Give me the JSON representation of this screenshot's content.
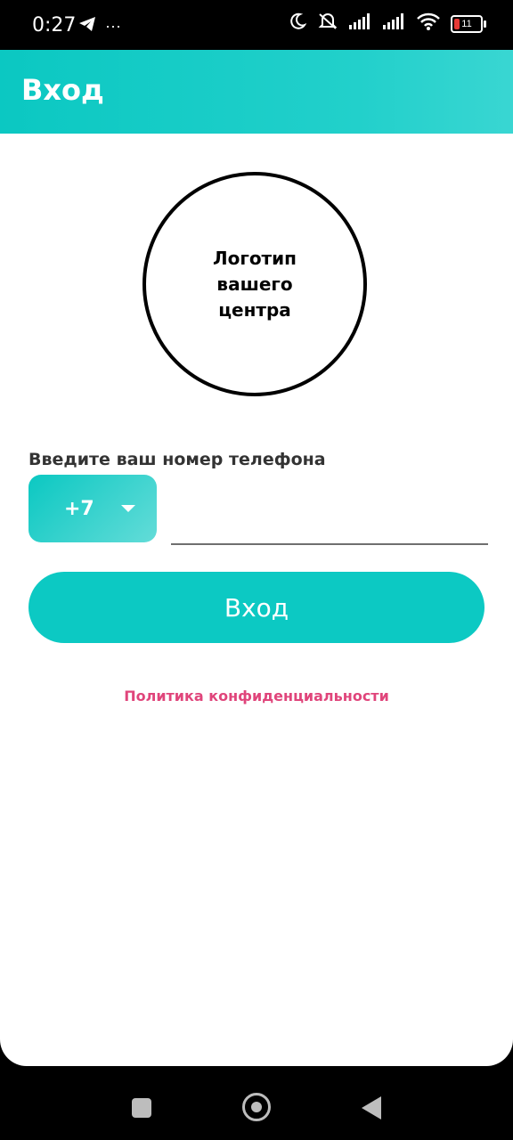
{
  "status_bar": {
    "time": "0:27",
    "more_dots": "···",
    "battery_level": "11"
  },
  "header": {
    "title": "Вход"
  },
  "logo": {
    "text": "Логотип\nвашего\nцентра"
  },
  "phone": {
    "label": "Введите ваш номер телефона",
    "country_code": "+7",
    "value": "",
    "placeholder": ""
  },
  "login_button": {
    "label": "Вход"
  },
  "privacy_link": {
    "text": "Политика конфиденциальности"
  },
  "colors": {
    "accent": "#0cc9c3",
    "link": "#e0457b"
  },
  "icons": [
    "telegram-icon",
    "moon-icon",
    "mute-icon",
    "signal-icon",
    "signal-icon-2",
    "wifi-icon",
    "battery-icon"
  ]
}
